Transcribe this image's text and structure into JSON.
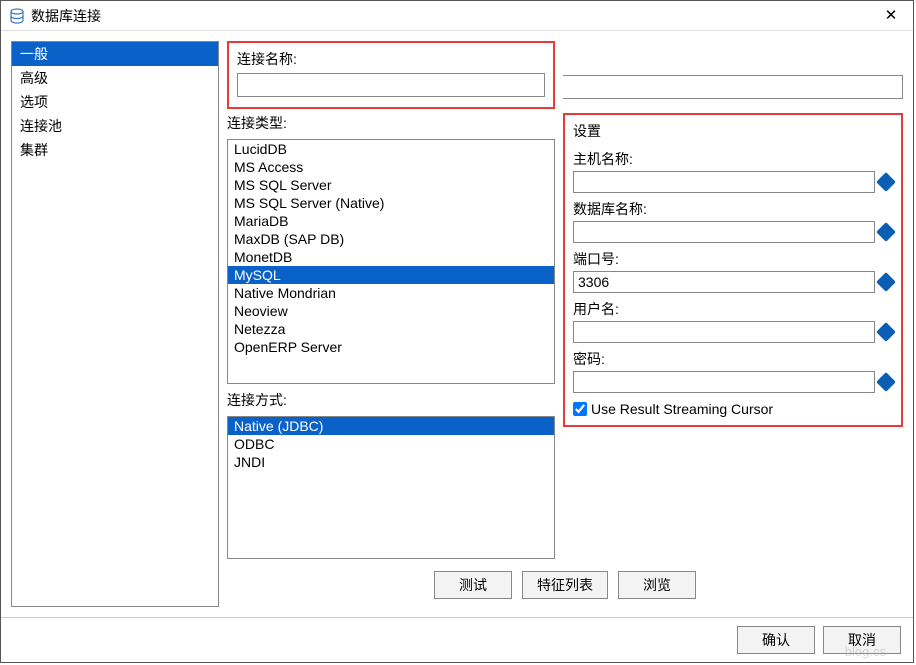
{
  "window": {
    "title": "数据库连接",
    "close": "✕"
  },
  "sidebar": {
    "items": [
      {
        "label": "一般",
        "selected": true
      },
      {
        "label": "高级",
        "selected": false
      },
      {
        "label": "选项",
        "selected": false
      },
      {
        "label": "连接池",
        "selected": false
      },
      {
        "label": "集群",
        "selected": false
      }
    ]
  },
  "connection_name": {
    "label": "连接名称:",
    "value": ""
  },
  "connection_type": {
    "label": "连接类型:",
    "items": [
      {
        "label": "LucidDB",
        "selected": false
      },
      {
        "label": "MS Access",
        "selected": false
      },
      {
        "label": "MS SQL Server",
        "selected": false
      },
      {
        "label": "MS SQL Server (Native)",
        "selected": false
      },
      {
        "label": "MariaDB",
        "selected": false
      },
      {
        "label": "MaxDB (SAP DB)",
        "selected": false
      },
      {
        "label": "MonetDB",
        "selected": false
      },
      {
        "label": "MySQL",
        "selected": true
      },
      {
        "label": "Native Mondrian",
        "selected": false
      },
      {
        "label": "Neoview",
        "selected": false
      },
      {
        "label": "Netezza",
        "selected": false
      },
      {
        "label": "OpenERP Server",
        "selected": false
      }
    ]
  },
  "connection_mode": {
    "label": "连接方式:",
    "items": [
      {
        "label": "Native (JDBC)",
        "selected": true
      },
      {
        "label": "ODBC",
        "selected": false
      },
      {
        "label": "JNDI",
        "selected": false
      }
    ]
  },
  "settings": {
    "legend": "设置",
    "host": {
      "label": "主机名称:",
      "value": ""
    },
    "database": {
      "label": "数据库名称:",
      "value": ""
    },
    "port": {
      "label": "端口号:",
      "value": "3306"
    },
    "username": {
      "label": "用户名:",
      "value": ""
    },
    "password": {
      "label": "密码:",
      "value": ""
    },
    "streaming": {
      "label": "Use Result Streaming Cursor",
      "checked": true
    }
  },
  "buttons": {
    "test": "测试",
    "feature_list": "特征列表",
    "browse": "浏览",
    "ok": "确认",
    "cancel": "取消"
  }
}
